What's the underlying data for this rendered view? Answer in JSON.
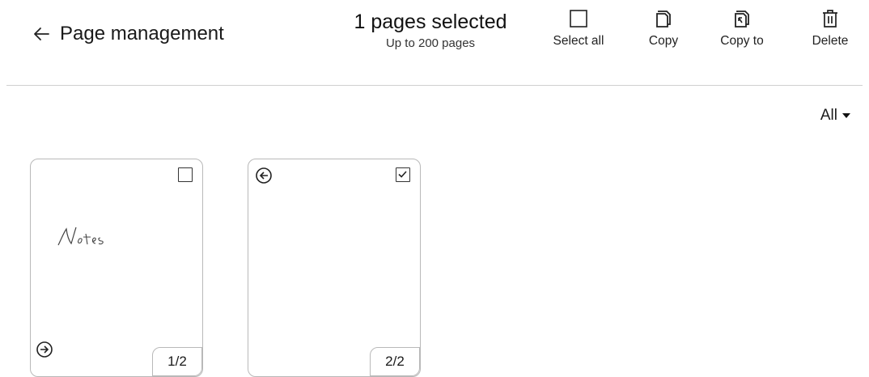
{
  "header": {
    "title": "Page management",
    "selection_title": "1 pages selected",
    "selection_subtitle": "Up to 200 pages"
  },
  "toolbar": {
    "select_all": {
      "label": "Select all",
      "icon": "empty-checkbox-icon"
    },
    "copy": {
      "label": "Copy",
      "icon": "copy-page-icon"
    },
    "copy_to": {
      "label": "Copy to",
      "icon": "copy-to-icon"
    },
    "delete": {
      "label": "Delete",
      "icon": "trash-icon"
    }
  },
  "filter": {
    "label": "All",
    "icon": "caret-down-icon"
  },
  "pages": [
    {
      "number_label": "1/2",
      "selected": false,
      "handwritten": "Notes",
      "arrow": "forward"
    },
    {
      "number_label": "2/2",
      "selected": true,
      "handwritten": "",
      "arrow": "back"
    }
  ]
}
